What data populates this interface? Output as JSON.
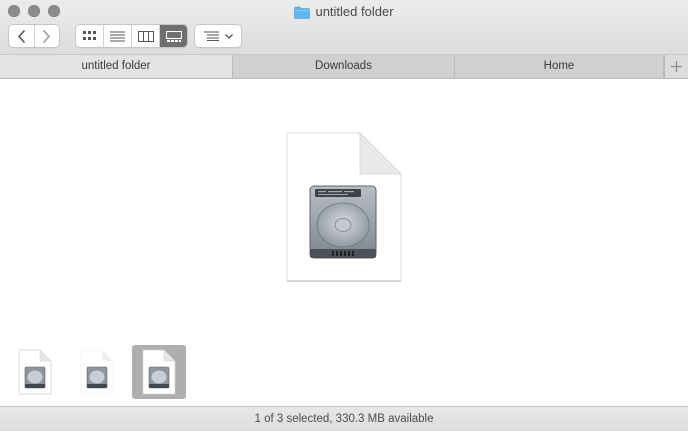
{
  "window": {
    "title": "untitled folder"
  },
  "toolbar": {
    "back": "back-chevron",
    "forward": "forward-chevron",
    "view_modes": [
      "icon-view",
      "list-view",
      "column-view",
      "gallery-view"
    ],
    "active_view": "gallery-view",
    "arrange": "arrange-menu"
  },
  "tabs": [
    {
      "label": "untitled folder",
      "active": true
    },
    {
      "label": "Downloads",
      "active": false
    },
    {
      "label": "Home",
      "active": false
    }
  ],
  "gallery": {
    "preview_icon": "disk-image-document-icon",
    "thumbnails": [
      {
        "icon": "disk-image-document-icon",
        "selected": false
      },
      {
        "icon": "disk-image-icon",
        "selected": false
      },
      {
        "icon": "disk-image-document-icon",
        "selected": true
      }
    ]
  },
  "status": {
    "text": "1 of 3 selected, 330.3 MB available"
  },
  "colors": {
    "folder_blue": "#5fb6f0",
    "active_segment": "#6f6f6f",
    "selection": "#aeaeae"
  }
}
